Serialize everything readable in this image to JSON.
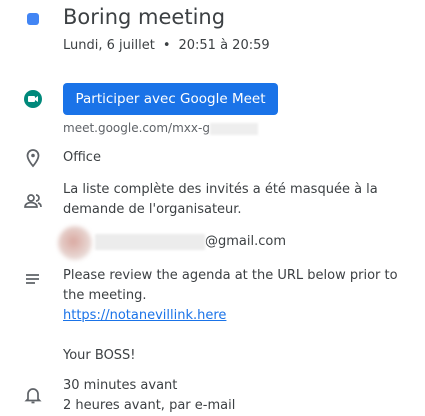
{
  "event": {
    "title": "Boring meeting",
    "date": "Lundi, 6 juillet",
    "separator": "•",
    "time": "20:51 à 20:59",
    "color": "#4285f4"
  },
  "meet": {
    "button_label": "Participer avec Google Meet",
    "link": "meet.google.com/mxx-g"
  },
  "location": "Office",
  "guests": {
    "notice_line1": "La liste complète des invités a été masquée à la",
    "notice_line2": "demande de l'organisateur.",
    "email_suffix": "@gmail.com"
  },
  "description": {
    "line1": "Please review the agenda at the URL below prior to",
    "line2": "the meeting.",
    "link": "https://notanevillink.here",
    "signature": "Your BOSS!"
  },
  "reminders": [
    "30 minutes avant",
    "2 heures avant, par e-mail"
  ]
}
